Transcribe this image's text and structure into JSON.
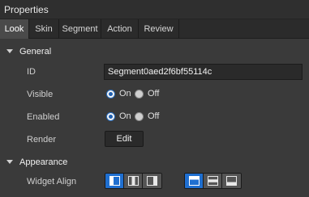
{
  "panel": {
    "title": "Properties"
  },
  "tabs": [
    {
      "label": "Look",
      "active": true
    },
    {
      "label": "Skin",
      "active": false
    },
    {
      "label": "Segment",
      "active": false
    },
    {
      "label": "Action",
      "active": false
    },
    {
      "label": "Review",
      "active": false
    }
  ],
  "general": {
    "heading": "General",
    "id": {
      "label": "ID",
      "value": "Segment0aed2f6bf55114c"
    },
    "visible": {
      "label": "Visible",
      "on": "On",
      "off": "Off",
      "selected": "On"
    },
    "enabled": {
      "label": "Enabled",
      "on": "On",
      "off": "Off",
      "selected": "On"
    },
    "render": {
      "label": "Render",
      "button": "Edit"
    }
  },
  "appearance": {
    "heading": "Appearance",
    "widget_align": {
      "label": "Widget Align",
      "horizontal_selected": "left",
      "vertical_selected": "top"
    }
  },
  "colors": {
    "accent": "#1f6fd0",
    "panel": "#3a3a3a",
    "tab_active": "#4a4a4a"
  }
}
